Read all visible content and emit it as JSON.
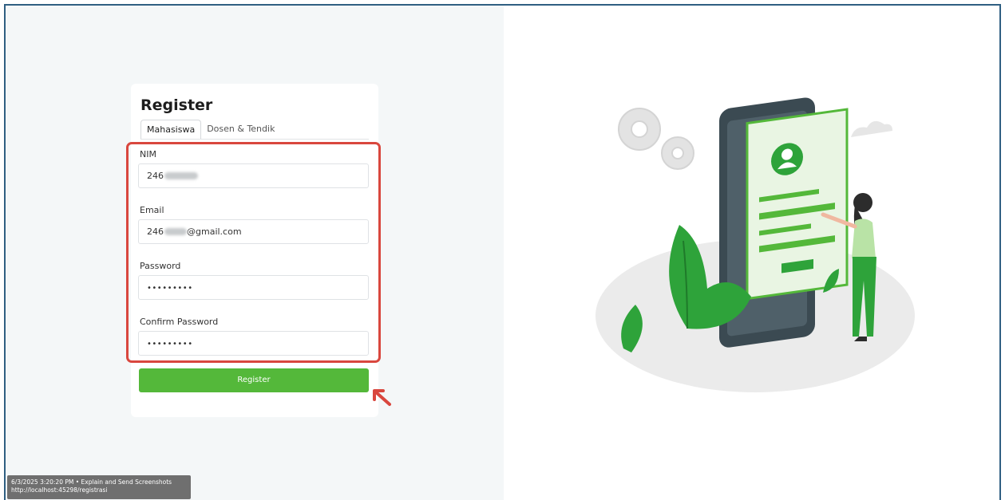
{
  "form": {
    "title": "Register",
    "tabs": [
      {
        "label": "Mahasiswa",
        "active": true
      },
      {
        "label": "Dosen & Tendik",
        "active": false
      }
    ],
    "fields": {
      "nim": {
        "label": "NIM",
        "value_visible_prefix": "246"
      },
      "email": {
        "label": "Email",
        "value_visible_prefix": "246",
        "value_visible_suffix": "@gmail.com"
      },
      "password": {
        "label": "Password",
        "value": "•••••••••"
      },
      "confirm_password": {
        "label": "Confirm Password",
        "value": "•••••••••"
      }
    },
    "submit_label": "Register"
  },
  "tooltip": {
    "line1": "6/3/2025 3:20:20 PM • Explain and Send Screenshots",
    "line2": "http://localhost:45298/registrasi"
  },
  "colors": {
    "accent_green": "#54b83a",
    "highlight_red": "#d9473e",
    "left_background": "#f4f7f8",
    "frame_border": "#2f5f82"
  }
}
